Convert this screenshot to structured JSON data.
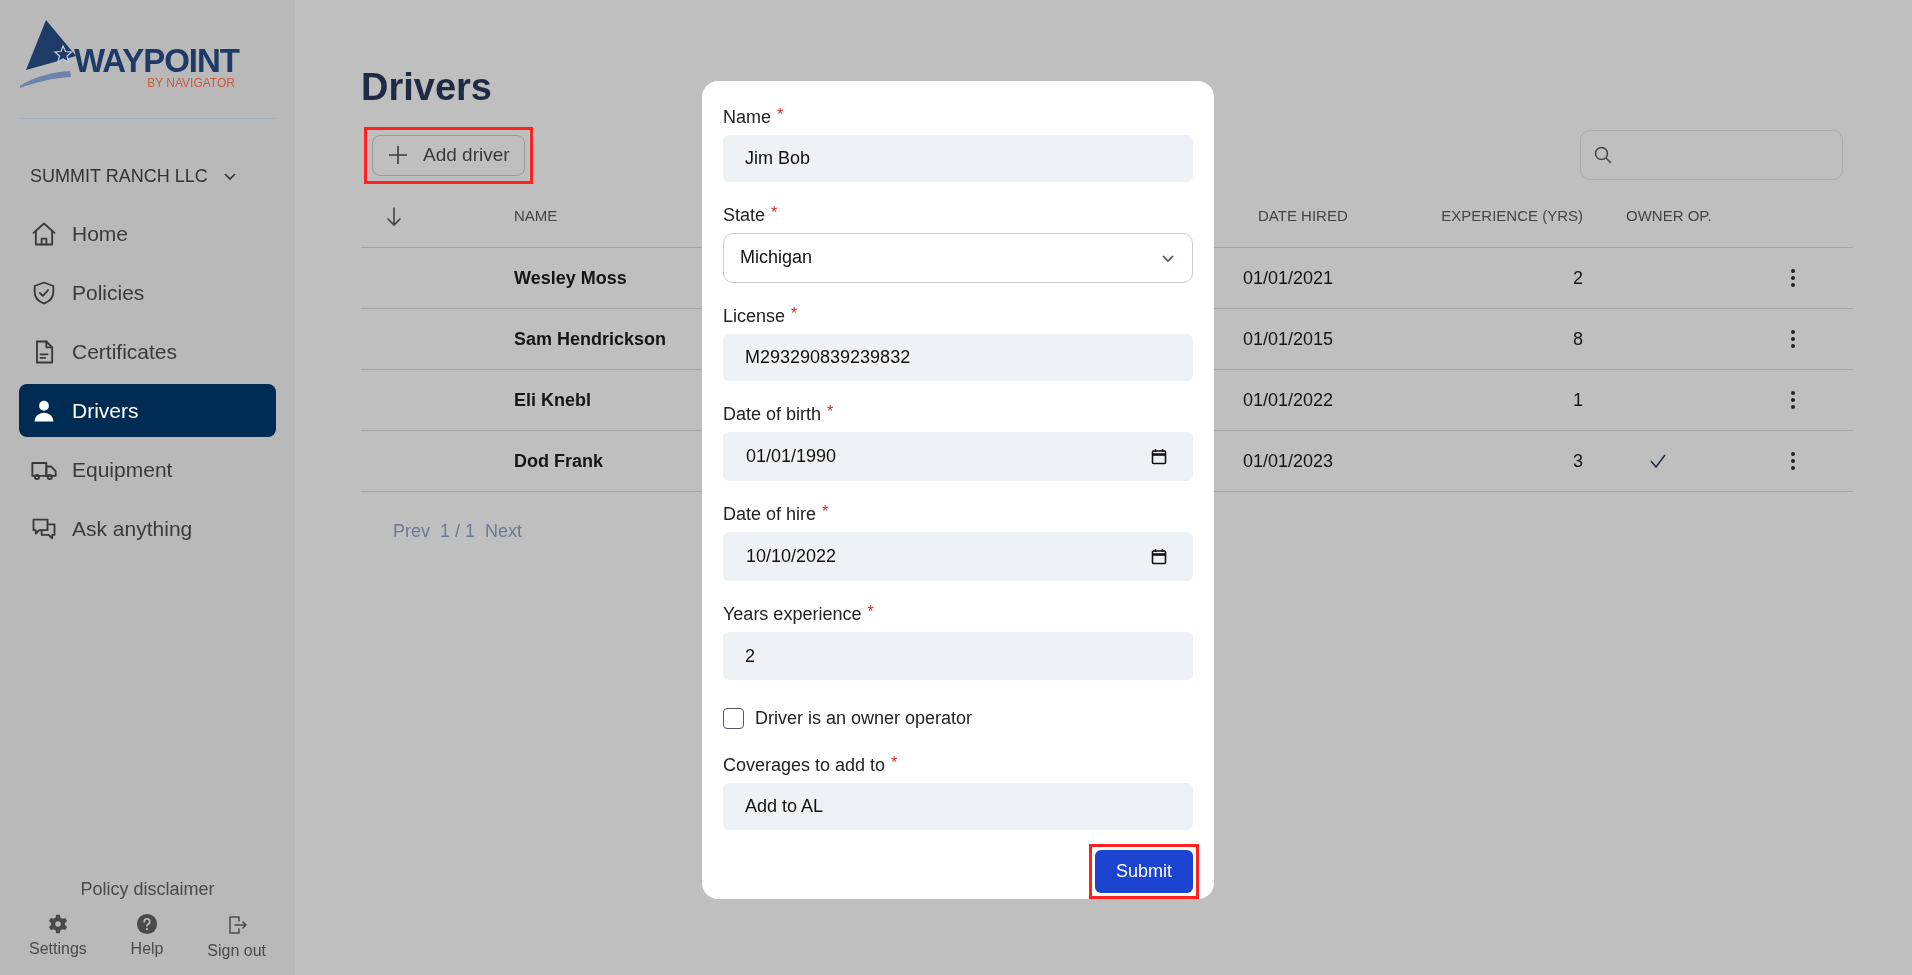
{
  "sidebar": {
    "logo": {
      "wordmark": "WAYPOINT",
      "tagline": "BY NAVIGATOR"
    },
    "company": "SUMMIT RANCH LLC",
    "items": [
      {
        "label": "Home",
        "selected": false
      },
      {
        "label": "Policies",
        "selected": false
      },
      {
        "label": "Certificates",
        "selected": false
      },
      {
        "label": "Drivers",
        "selected": true
      },
      {
        "label": "Equipment",
        "selected": false
      },
      {
        "label": "Ask anything",
        "selected": false
      }
    ],
    "disclaimer": "Policy disclaimer",
    "footer_actions": [
      "Settings",
      "Help",
      "Sign out"
    ]
  },
  "page": {
    "title": "Drivers",
    "add_button": "Add driver"
  },
  "table": {
    "columns": [
      "NAME",
      "DATE HIRED",
      "EXPERIENCE (YRS)",
      "OWNER OP."
    ],
    "rows": [
      {
        "name": "Wesley Moss",
        "date_hired": "01/01/2021",
        "experience": "2",
        "owner_operator": false
      },
      {
        "name": "Sam Hendrickson",
        "date_hired": "01/01/2015",
        "experience": "8",
        "owner_operator": false
      },
      {
        "name": "Eli Knebl",
        "date_hired": "01/01/2022",
        "experience": "1",
        "owner_operator": false
      },
      {
        "name": "Dod Frank",
        "date_hired": "01/01/2023",
        "experience": "3",
        "owner_operator": true
      }
    ]
  },
  "pagination": {
    "prev": "Prev",
    "page": "1 / 1",
    "next": "Next"
  },
  "dialog": {
    "fields": [
      {
        "kind": "text",
        "label": "Name",
        "required_mark": "*",
        "value": "Jim Bob"
      },
      {
        "kind": "select",
        "label": "State",
        "required_mark": "*",
        "value": "Michigan"
      },
      {
        "kind": "text",
        "label": "License",
        "required_mark": "*",
        "value": "M293290839239832"
      },
      {
        "kind": "date",
        "label": "Date of birth",
        "required_mark": "*",
        "value": "01/01/1990"
      },
      {
        "kind": "date",
        "label": "Date of hire",
        "required_mark": "*",
        "value": "10/10/2022"
      },
      {
        "kind": "text",
        "label": "Years experience",
        "required_mark": "*",
        "value": "2"
      },
      {
        "kind": "checkbox",
        "label": "Driver is an owner operator",
        "checked": false
      },
      {
        "kind": "text",
        "label": "Coverages to add to",
        "required_mark": "*",
        "value": "Add to AL"
      }
    ],
    "submit": "Submit"
  }
}
